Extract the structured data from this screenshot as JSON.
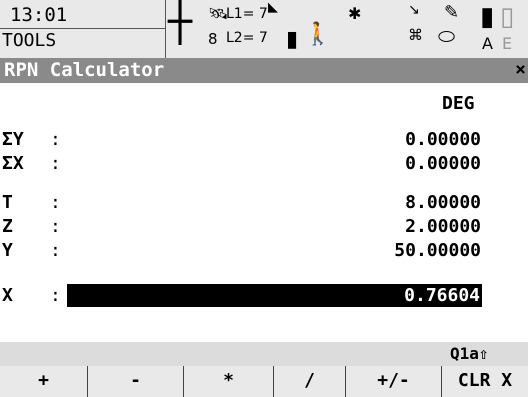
{
  "status": {
    "time": "13:01",
    "mode": "TOOLS",
    "l1": "L1= 7",
    "l2": "L2= 7",
    "sat_count": "8",
    "keyboard": "A",
    "keyboard2": "E"
  },
  "window": {
    "title": "RPN Calculator",
    "close": "×"
  },
  "angle_mode": "DEG",
  "registers": [
    {
      "label": "ΣY",
      "value": "0.00000"
    },
    {
      "label": "ΣX",
      "value": "0.00000"
    },
    {
      "label": "T",
      "value": "8.00000"
    },
    {
      "label": "Z",
      "value": "2.00000"
    },
    {
      "label": "Y",
      "value": "50.00000"
    },
    {
      "label": "X",
      "value": "0.76604"
    }
  ],
  "input_mode": "Q1a⇧",
  "softkeys": [
    "+",
    "-",
    "*",
    "/",
    "+/-",
    "CLR X"
  ],
  "colors": {
    "title_bar": "#8a8a8a",
    "status_bar": "#e9e9e9",
    "highlight": "#000000"
  }
}
